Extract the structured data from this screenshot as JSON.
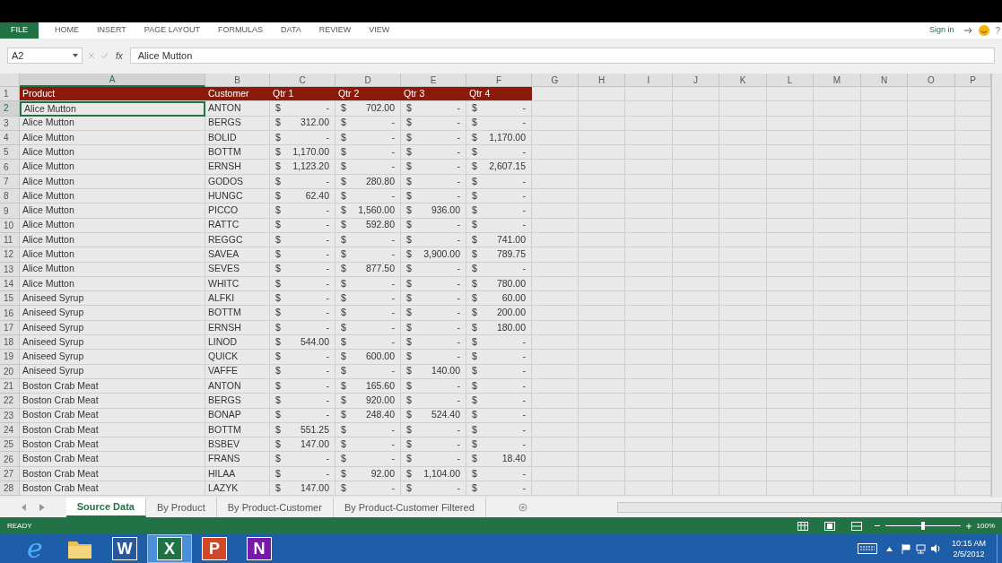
{
  "ribbon": {
    "tabs": [
      {
        "label": "FILE",
        "kind": "file",
        "selected": false
      },
      {
        "label": "HOME",
        "kind": "tab",
        "selected": false
      },
      {
        "label": "INSERT",
        "kind": "tab",
        "selected": false
      },
      {
        "label": "PAGE LAYOUT",
        "kind": "tab",
        "selected": false
      },
      {
        "label": "FORMULAS",
        "kind": "tab",
        "selected": false
      },
      {
        "label": "DATA",
        "kind": "tab",
        "selected": false
      },
      {
        "label": "REVIEW",
        "kind": "tab",
        "selected": false
      },
      {
        "label": "VIEW",
        "kind": "tab",
        "selected": false
      }
    ],
    "sign_in": "Sign in",
    "help": "?"
  },
  "formula_bar": {
    "name_box": "A2",
    "function_label": "fx",
    "value": "Alice Mutton"
  },
  "columns": [
    {
      "label": "A",
      "selected": true
    },
    {
      "label": "B",
      "selected": false
    },
    {
      "label": "C",
      "selected": false
    },
    {
      "label": "D",
      "selected": false
    },
    {
      "label": "E",
      "selected": false
    },
    {
      "label": "F",
      "selected": false
    },
    {
      "label": "G",
      "selected": false
    },
    {
      "label": "H",
      "selected": false
    },
    {
      "label": "I",
      "selected": false
    },
    {
      "label": "J",
      "selected": false
    },
    {
      "label": "K",
      "selected": false
    },
    {
      "label": "L",
      "selected": false
    },
    {
      "label": "M",
      "selected": false
    },
    {
      "label": "N",
      "selected": false
    },
    {
      "label": "O",
      "selected": false
    },
    {
      "label": "P",
      "selected": false
    }
  ],
  "header_row": {
    "num": "1",
    "cells": [
      "Product",
      "Customer",
      "Qtr 1",
      "Qtr 2",
      "Qtr 3",
      "Qtr 4"
    ]
  },
  "rows": [
    {
      "num": "2",
      "selected": true,
      "product": "Alice Mutton",
      "customer": "ANTON",
      "amounts": [
        [
          "$",
          "-"
        ],
        [
          "$",
          "702.00"
        ],
        [
          "$",
          "-"
        ],
        [
          "$",
          "-"
        ]
      ]
    },
    {
      "num": "3",
      "selected": false,
      "product": "Alice Mutton",
      "customer": "BERGS",
      "amounts": [
        [
          "$",
          "312.00"
        ],
        [
          "$",
          "-"
        ],
        [
          "$",
          "-"
        ],
        [
          "$",
          "-"
        ]
      ]
    },
    {
      "num": "4",
      "selected": false,
      "product": "Alice Mutton",
      "customer": "BOLID",
      "amounts": [
        [
          "$",
          "-"
        ],
        [
          "$",
          "-"
        ],
        [
          "$",
          "-"
        ],
        [
          "$",
          "1,170.00"
        ]
      ]
    },
    {
      "num": "5",
      "selected": false,
      "product": "Alice Mutton",
      "customer": "BOTTM",
      "amounts": [
        [
          "$",
          "1,170.00"
        ],
        [
          "$",
          "-"
        ],
        [
          "$",
          "-"
        ],
        [
          "$",
          "-"
        ]
      ]
    },
    {
      "num": "6",
      "selected": false,
      "product": "Alice Mutton",
      "customer": "ERNSH",
      "amounts": [
        [
          "$",
          "1,123.20"
        ],
        [
          "$",
          "-"
        ],
        [
          "$",
          "-"
        ],
        [
          "$",
          "2,607.15"
        ]
      ]
    },
    {
      "num": "7",
      "selected": false,
      "product": "Alice Mutton",
      "customer": "GODOS",
      "amounts": [
        [
          "$",
          "-"
        ],
        [
          "$",
          "280.80"
        ],
        [
          "$",
          "-"
        ],
        [
          "$",
          "-"
        ]
      ]
    },
    {
      "num": "8",
      "selected": false,
      "product": "Alice Mutton",
      "customer": "HUNGC",
      "amounts": [
        [
          "$",
          "62.40"
        ],
        [
          "$",
          "-"
        ],
        [
          "$",
          "-"
        ],
        [
          "$",
          "-"
        ]
      ]
    },
    {
      "num": "9",
      "selected": false,
      "product": "Alice Mutton",
      "customer": "PICCO",
      "amounts": [
        [
          "$",
          "-"
        ],
        [
          "$",
          "1,560.00"
        ],
        [
          "$",
          "936.00"
        ],
        [
          "$",
          "-"
        ]
      ]
    },
    {
      "num": "10",
      "selected": false,
      "product": "Alice Mutton",
      "customer": "RATTC",
      "amounts": [
        [
          "$",
          "-"
        ],
        [
          "$",
          "592.80"
        ],
        [
          "$",
          "-"
        ],
        [
          "$",
          "-"
        ]
      ]
    },
    {
      "num": "11",
      "selected": false,
      "product": "Alice Mutton",
      "customer": "REGGC",
      "amounts": [
        [
          "$",
          "-"
        ],
        [
          "$",
          "-"
        ],
        [
          "$",
          "-"
        ],
        [
          "$",
          "741.00"
        ]
      ]
    },
    {
      "num": "12",
      "selected": false,
      "product": "Alice Mutton",
      "customer": "SAVEA",
      "amounts": [
        [
          "$",
          "-"
        ],
        [
          "$",
          "-"
        ],
        [
          "$",
          "3,900.00"
        ],
        [
          "$",
          "789.75"
        ]
      ]
    },
    {
      "num": "13",
      "selected": false,
      "product": "Alice Mutton",
      "customer": "SEVES",
      "amounts": [
        [
          "$",
          "-"
        ],
        [
          "$",
          "877.50"
        ],
        [
          "$",
          "-"
        ],
        [
          "$",
          "-"
        ]
      ]
    },
    {
      "num": "14",
      "selected": false,
      "product": "Alice Mutton",
      "customer": "WHITC",
      "amounts": [
        [
          "$",
          "-"
        ],
        [
          "$",
          "-"
        ],
        [
          "$",
          "-"
        ],
        [
          "$",
          "780.00"
        ]
      ]
    },
    {
      "num": "15",
      "selected": false,
      "product": "Aniseed Syrup",
      "customer": "ALFKI",
      "amounts": [
        [
          "$",
          "-"
        ],
        [
          "$",
          "-"
        ],
        [
          "$",
          "-"
        ],
        [
          "$",
          "60.00"
        ]
      ]
    },
    {
      "num": "16",
      "selected": false,
      "product": "Aniseed Syrup",
      "customer": "BOTTM",
      "amounts": [
        [
          "$",
          "-"
        ],
        [
          "$",
          "-"
        ],
        [
          "$",
          "-"
        ],
        [
          "$",
          "200.00"
        ]
      ]
    },
    {
      "num": "17",
      "selected": false,
      "product": "Aniseed Syrup",
      "customer": "ERNSH",
      "amounts": [
        [
          "$",
          "-"
        ],
        [
          "$",
          "-"
        ],
        [
          "$",
          "-"
        ],
        [
          "$",
          "180.00"
        ]
      ]
    },
    {
      "num": "18",
      "selected": false,
      "product": "Aniseed Syrup",
      "customer": "LINOD",
      "amounts": [
        [
          "$",
          "544.00"
        ],
        [
          "$",
          "-"
        ],
        [
          "$",
          "-"
        ],
        [
          "$",
          "-"
        ]
      ]
    },
    {
      "num": "19",
      "selected": false,
      "product": "Aniseed Syrup",
      "customer": "QUICK",
      "amounts": [
        [
          "$",
          "-"
        ],
        [
          "$",
          "600.00"
        ],
        [
          "$",
          "-"
        ],
        [
          "$",
          "-"
        ]
      ]
    },
    {
      "num": "20",
      "selected": false,
      "product": "Aniseed Syrup",
      "customer": "VAFFE",
      "amounts": [
        [
          "$",
          "-"
        ],
        [
          "$",
          "-"
        ],
        [
          "$",
          "140.00"
        ],
        [
          "$",
          "-"
        ]
      ]
    },
    {
      "num": "21",
      "selected": false,
      "product": "Boston Crab Meat",
      "customer": "ANTON",
      "amounts": [
        [
          "$",
          "-"
        ],
        [
          "$",
          "165.60"
        ],
        [
          "$",
          "-"
        ],
        [
          "$",
          "-"
        ]
      ]
    },
    {
      "num": "22",
      "selected": false,
      "product": "Boston Crab Meat",
      "customer": "BERGS",
      "amounts": [
        [
          "$",
          "-"
        ],
        [
          "$",
          "920.00"
        ],
        [
          "$",
          "-"
        ],
        [
          "$",
          "-"
        ]
      ]
    },
    {
      "num": "23",
      "selected": false,
      "product": "Boston Crab Meat",
      "customer": "BONAP",
      "amounts": [
        [
          "$",
          "-"
        ],
        [
          "$",
          "248.40"
        ],
        [
          "$",
          "524.40"
        ],
        [
          "$",
          "-"
        ]
      ]
    },
    {
      "num": "24",
      "selected": false,
      "product": "Boston Crab Meat",
      "customer": "BOTTM",
      "amounts": [
        [
          "$",
          "551.25"
        ],
        [
          "$",
          "-"
        ],
        [
          "$",
          "-"
        ],
        [
          "$",
          "-"
        ]
      ]
    },
    {
      "num": "25",
      "selected": false,
      "product": "Boston Crab Meat",
      "customer": "BSBEV",
      "amounts": [
        [
          "$",
          "147.00"
        ],
        [
          "$",
          "-"
        ],
        [
          "$",
          "-"
        ],
        [
          "$",
          "-"
        ]
      ]
    },
    {
      "num": "26",
      "selected": false,
      "product": "Boston Crab Meat",
      "customer": "FRANS",
      "amounts": [
        [
          "$",
          "-"
        ],
        [
          "$",
          "-"
        ],
        [
          "$",
          "-"
        ],
        [
          "$",
          "18.40"
        ]
      ]
    },
    {
      "num": "27",
      "selected": false,
      "product": "Boston Crab Meat",
      "customer": "HILAA",
      "amounts": [
        [
          "$",
          "-"
        ],
        [
          "$",
          "92.00"
        ],
        [
          "$",
          "1,104.00"
        ],
        [
          "$",
          "-"
        ]
      ]
    },
    {
      "num": "28",
      "selected": false,
      "product": "Boston Crab Meat",
      "customer": "LAZYK",
      "amounts": [
        [
          "$",
          "147.00"
        ],
        [
          "$",
          "-"
        ],
        [
          "$",
          "-"
        ],
        [
          "$",
          "-"
        ]
      ]
    }
  ],
  "sheet_tabs": [
    {
      "label": "Source Data",
      "selected": true
    },
    {
      "label": "By Product",
      "selected": false
    },
    {
      "label": "By Product-Customer",
      "selected": false
    },
    {
      "label": "By Product-Customer Filtered",
      "selected": false
    }
  ],
  "status_bar": {
    "status": "READY",
    "zoom": {
      "level": 0.5,
      "reading": "100%"
    }
  },
  "taskbar": {
    "apps": [
      {
        "kind": "browser",
        "letter": "e",
        "selected": false
      },
      {
        "kind": "folder",
        "selected": false
      },
      {
        "kind": "office",
        "letter": "W",
        "color": "#2b579a",
        "selected": false
      },
      {
        "kind": "office",
        "letter": "X",
        "color": "#217346",
        "selected": true
      },
      {
        "kind": "office",
        "letter": "P",
        "color": "#d24726",
        "selected": false
      },
      {
        "kind": "office",
        "letter": "N",
        "color": "#7719aa",
        "selected": false
      }
    ],
    "time": "10:15 AM",
    "date": "2/5/2012"
  }
}
